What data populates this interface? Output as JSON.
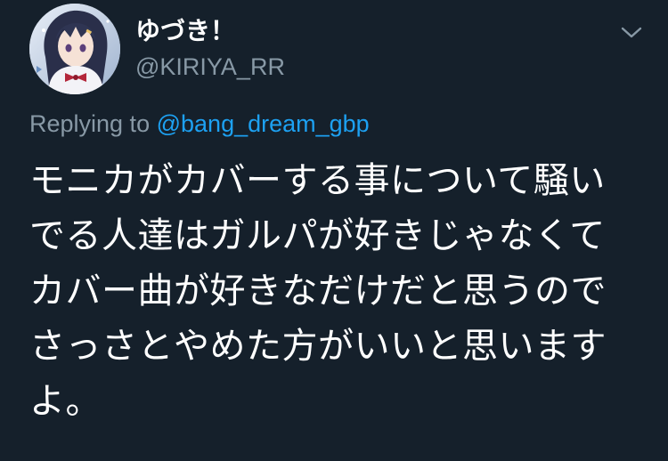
{
  "tweet": {
    "author": {
      "display_name": "ゆづき！",
      "handle": "@KIRIYA_RR",
      "avatar_icon": "avatar-anime-girl"
    },
    "menu_icon": "chevron-down-icon",
    "reply": {
      "prefix": "Replying to",
      "mention": "@bang_dream_gbp"
    },
    "text_lines": [
      "モニカがカバーする事について騒い",
      "でる人達はガルパが好きじゃなくて",
      "カバー曲が好きなだけだと思うので",
      "さっさとやめた方がいいと思います",
      "よ。"
    ]
  },
  "colors": {
    "background": "#15202b",
    "primary_text": "#ffffff",
    "secondary_text": "#8899a6",
    "accent": "#1da1f2"
  }
}
